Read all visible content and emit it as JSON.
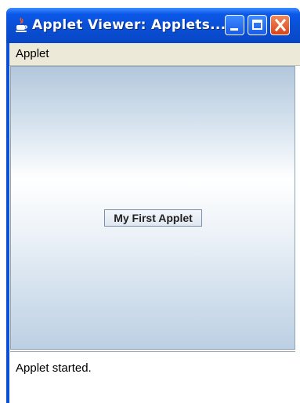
{
  "window": {
    "title": "Applet Viewer: Applets..."
  },
  "menubar": {
    "items": [
      {
        "label": "Applet"
      }
    ]
  },
  "applet": {
    "button_label": "My First Applet"
  },
  "status": {
    "text": "Applet started."
  },
  "icons": {
    "app": "java-cup-icon",
    "minimize": "minimize-icon",
    "maximize": "maximize-icon",
    "close": "close-icon"
  },
  "colors": {
    "titlebar": "#0a4fd4",
    "close_button": "#d9441a",
    "menubar": "#ece9d8"
  }
}
